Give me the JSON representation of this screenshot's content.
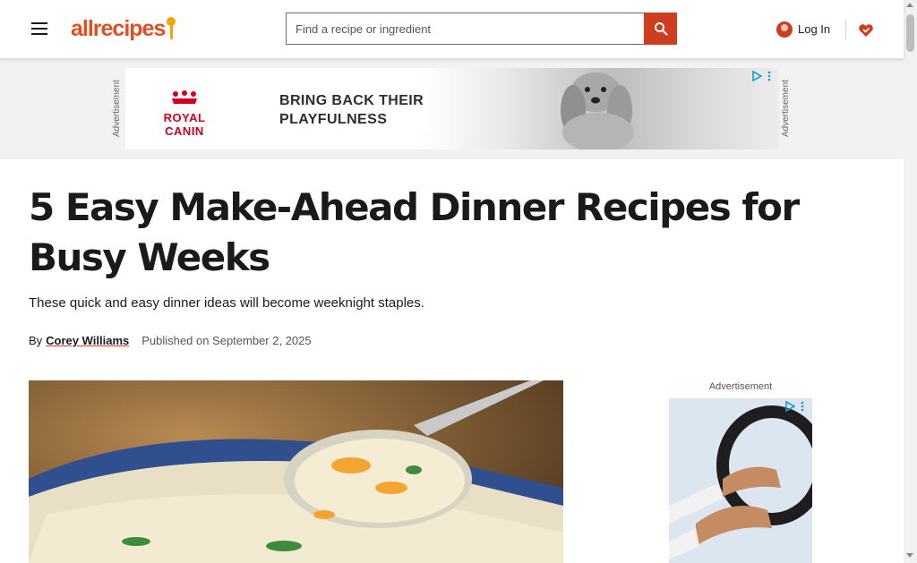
{
  "header": {
    "logo_text": "allrecipes",
    "search_placeholder": "Find a recipe or ingredient",
    "search_value": "",
    "login_label": "Log In",
    "brand_color": "#e04f24",
    "accent_color": "#ce3d1d"
  },
  "ad_banner": {
    "side_label": "Advertisement",
    "brand": "ROYAL CANIN",
    "headline_line1": "BRING BACK THEIR",
    "headline_line2": "PLAYFULNESS"
  },
  "article": {
    "title": "5 Easy Make-Ahead Dinner Recipes for Busy Weeks",
    "subtitle": "These quick and easy dinner ideas will become weeknight staples.",
    "by_label": "By",
    "author": "Corey Williams",
    "published": "Published on September 2, 2025"
  },
  "sidebar_ad": {
    "label": "Advertisement"
  },
  "icons": {
    "menu": "hamburger-menu-icon",
    "search": "search-icon",
    "user": "user-avatar-icon",
    "favorites": "heart-icon",
    "ad_choices": "ad-choices-icon"
  }
}
